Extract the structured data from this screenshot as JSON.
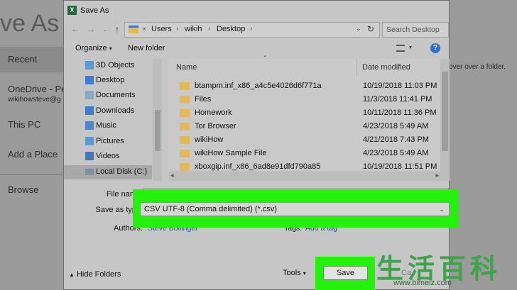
{
  "backstage": {
    "title": "ve As",
    "items": [
      "Recent",
      "OneDrive - Pe",
      "This PC",
      "Add a Place",
      "Browse"
    ],
    "onedrive_sub": "wikihowsteve@g",
    "hover_hint": "over over a folder."
  },
  "dialog": {
    "title": "Save As",
    "breadcrumbs": [
      "Users",
      "wikih",
      "Desktop"
    ],
    "search_placeholder": "Search Desktop",
    "toolbar": {
      "organize": "Organize",
      "new_folder": "New folder"
    },
    "nav_items": [
      {
        "label": "3D Objects",
        "icon": "3d-objects-icon"
      },
      {
        "label": "Desktop",
        "icon": "desktop-icon"
      },
      {
        "label": "Documents",
        "icon": "documents-icon"
      },
      {
        "label": "Downloads",
        "icon": "downloads-icon"
      },
      {
        "label": "Music",
        "icon": "music-icon"
      },
      {
        "label": "Pictures",
        "icon": "pictures-icon"
      },
      {
        "label": "Videos",
        "icon": "videos-icon"
      },
      {
        "label": "Local Disk (C:)",
        "icon": "drive-icon"
      }
    ],
    "columns": {
      "name": "Name",
      "date_modified": "Date modified"
    },
    "files": [
      {
        "name": "btampm.inf_x86_a4c5e4026d6f771a",
        "date": "10/19/2018 11:03 PM"
      },
      {
        "name": "Files",
        "date": "11/3/2018 11:41 PM"
      },
      {
        "name": "Homework",
        "date": "10/11/2018 11:36 PM"
      },
      {
        "name": "Tor Browser",
        "date": "4/23/2018 5:49 AM"
      },
      {
        "name": "wikiHow",
        "date": "4/21/2018 7:43 PM"
      },
      {
        "name": "wikiHow Sample File",
        "date": "4/23/2018 5:49 AM"
      },
      {
        "name": "xboxgip.inf_x86_6ad8e91dfd790a85",
        "date": "10/19/2018 11:51 PM"
      }
    ],
    "fields": {
      "file_name_label": "File nam",
      "save_as_type_label": "Save as typ",
      "save_as_type_value": "CSV UTF-8 (Comma delimited) (*.csv)",
      "authors_label": "Authors:",
      "authors_value": "Steve Bollinger",
      "tags_label": "Tags:",
      "tags_value": "Add a tag"
    },
    "footer": {
      "hide_folders": "Hide Folders",
      "tools": "Tools",
      "save": "Save",
      "cancel_partial": "Ca"
    }
  },
  "watermark": {
    "chars": "生活百科",
    "url": "www.bimeiz.com"
  },
  "colors": {
    "highlight": "#25f20c",
    "folder": "#e2b955",
    "help": "#2e6fd1"
  }
}
